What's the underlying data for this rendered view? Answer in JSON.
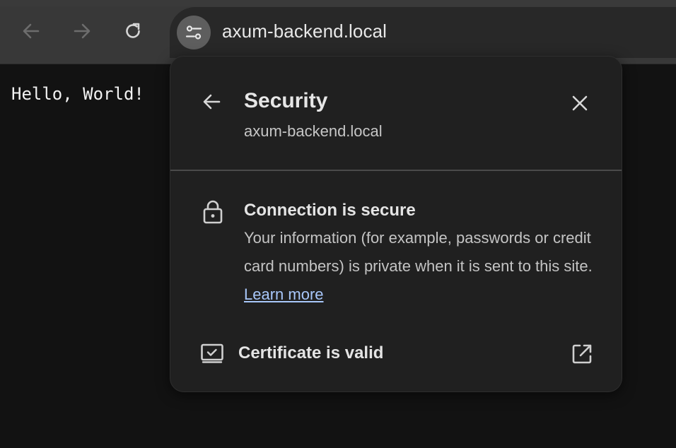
{
  "browser": {
    "url": "axum-backend.local",
    "icons": {
      "back": "arrow-left-icon",
      "forward": "arrow-right-icon",
      "reload": "reload-icon",
      "site_info": "tune-icon"
    }
  },
  "page": {
    "body_text": "Hello, World!"
  },
  "popup": {
    "title": "Security",
    "subtitle": "axum-backend.local",
    "connection": {
      "title": "Connection is secure",
      "description": "Your information (for example, passwords or credit card numbers) is private when it is sent to this site.",
      "link_label": "Learn more"
    },
    "certificate": {
      "label": "Certificate is valid"
    }
  },
  "colors": {
    "toolbar": "#383838",
    "omnibox": "#282828",
    "popup_bg": "#202020",
    "link": "#a8c7fa",
    "page_bg": "#121212"
  }
}
